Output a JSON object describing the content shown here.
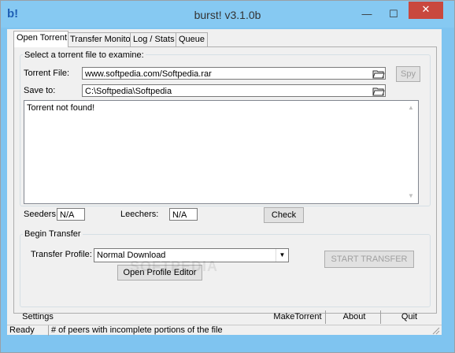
{
  "window": {
    "title": "burst! v3.1.0b",
    "app_icon": "b!",
    "minimize": "—",
    "maximize": "☐",
    "close": "✕"
  },
  "tabs": [
    {
      "label": "Open Torrent"
    },
    {
      "label": "Transfer Monitor"
    },
    {
      "label": "Log / Stats"
    },
    {
      "label": "Queue"
    }
  ],
  "select_group": {
    "legend": "Select a torrent file to examine:",
    "torrent_label": "Torrent File:",
    "torrent_value": "www.softpedia.com/Softpedia.rar",
    "save_label": "Save to:",
    "save_value": "C:\\Softpedia\\Softpedia",
    "spy_label": "Spy",
    "output_text": "Torrent not found!",
    "seeders_label": "Seeders:",
    "seeders_value": "N/A",
    "leechers_label": "Leechers:",
    "leechers_value": "N/A",
    "check_label": "Check"
  },
  "transfer_group": {
    "legend": "Begin Transfer",
    "profile_label": "Transfer Profile:",
    "profile_value": "Normal Download",
    "open_profile_editor": "Open Profile Editor",
    "start_transfer": "START TRANSFER"
  },
  "bottom": {
    "settings": "Settings",
    "maketorrent": "MakeTorrent",
    "about": "About",
    "quit": "Quit"
  },
  "status": {
    "left": "Ready",
    "right": "# of peers with incomplete portions of the file"
  },
  "watermark": "SOFTPEDIA",
  "colors": {
    "titlebar": "#86c9f2",
    "close_button": "#c9483e",
    "face": "#f0f0f0"
  }
}
